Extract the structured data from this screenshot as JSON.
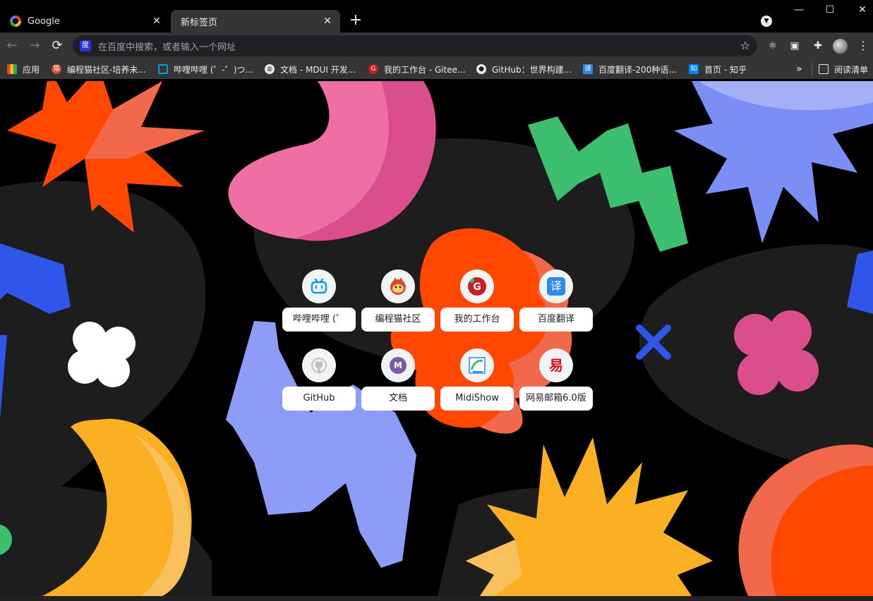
{
  "tabs": [
    {
      "title": "Google",
      "icon": "google-icon"
    },
    {
      "title": "新标签页",
      "icon": ""
    }
  ],
  "window": {
    "minimize": "—",
    "maximize": "☐",
    "close": "✕"
  },
  "toolbar": {
    "back": "←",
    "forward": "→",
    "reload": "⟳",
    "omnibox_placeholder": "在百度中搜索，或者输入一个网址",
    "star": "☆",
    "menu": "⋮"
  },
  "bookmarks": [
    {
      "label": "应用",
      "icon": "apps-grid-icon",
      "color": "#e8453c"
    },
    {
      "label": "编程猫社区-培养未...",
      "icon": "codemao-icon",
      "color": "#d9482b"
    },
    {
      "label": "哔哩哔哩 (゜-゜)つ...",
      "icon": "bilibili-icon",
      "color": "#00a1d6"
    },
    {
      "label": "文档 - MDUI 开发...",
      "icon": "globe-icon",
      "color": "#9aa0a6"
    },
    {
      "label": "我的工作台 - Gitee...",
      "icon": "gitee-icon",
      "color": "#c71d23"
    },
    {
      "label": "GitHub：世界构建...",
      "icon": "github-icon",
      "color": "#e8eaed"
    },
    {
      "label": "百度翻译-200种语...",
      "icon": "baidu-translate-icon",
      "color": "#2d88f0"
    },
    {
      "label": "首页 - 知乎",
      "icon": "zhihu-icon",
      "color": "#0084ff"
    }
  ],
  "more_bookmarks": "»",
  "reading_list": "阅读清单",
  "shortcuts": [
    {
      "label": "哔哩哔哩 (゜",
      "icon": "bilibili-icon"
    },
    {
      "label": "编程猫社区",
      "icon": "codemao-icon"
    },
    {
      "label": "我的工作台",
      "icon": "gitee-icon"
    },
    {
      "label": "百度翻译",
      "icon": "baidu-translate-icon"
    },
    {
      "label": "GitHub",
      "icon": "github-icon"
    },
    {
      "label": "文档",
      "icon": "mdui-icon"
    },
    {
      "label": "MidiShow",
      "icon": "midishow-icon"
    },
    {
      "label": "网易邮箱6.0版",
      "icon": "netease-mail-icon"
    }
  ],
  "glyphs": {
    "bilibili": "▭",
    "translate": "译",
    "zhihu": "知",
    "mdui": "M",
    "netease": "易",
    "gitee": "G"
  }
}
